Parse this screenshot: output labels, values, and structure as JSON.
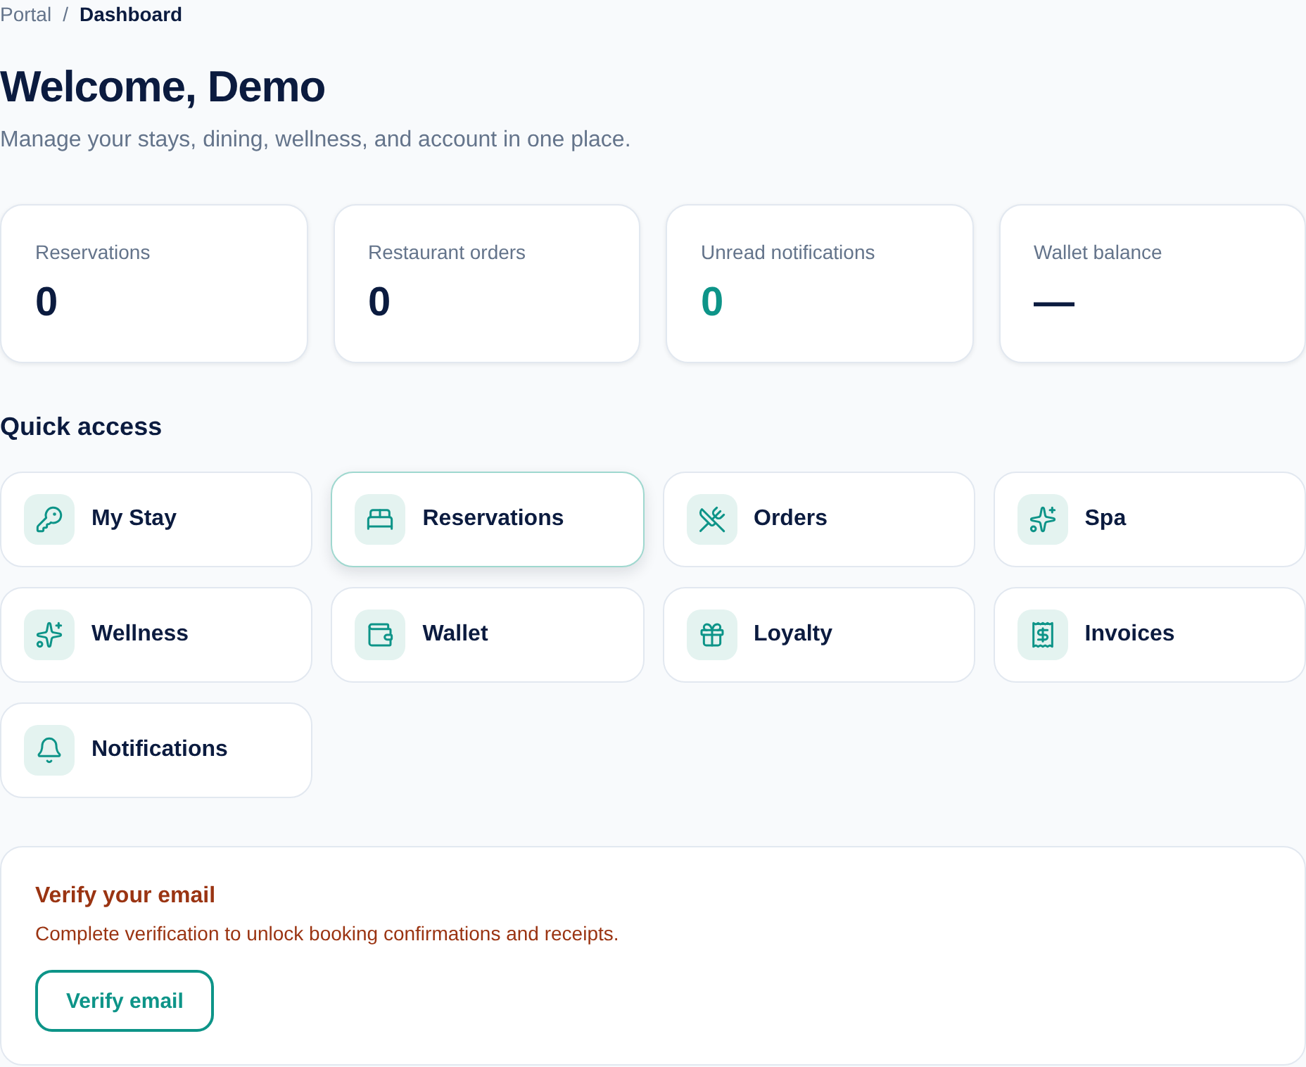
{
  "breadcrumb": {
    "items": [
      {
        "label": "Portal",
        "current": false
      },
      {
        "label": "Dashboard",
        "current": true
      }
    ],
    "separator": "/"
  },
  "header": {
    "title": "Welcome, Demo",
    "subtitle": "Manage your stays, dining, wellness, and account in one place."
  },
  "stats": [
    {
      "label": "Reservations",
      "value": "0",
      "color": "#0b1b3f"
    },
    {
      "label": "Restaurant orders",
      "value": "0",
      "color": "#0b1b3f"
    },
    {
      "label": "Unread notifications",
      "value": "0",
      "color": "#0d9488"
    },
    {
      "label": "Wallet balance",
      "value": "—",
      "color": "#0b1b3f"
    }
  ],
  "quick_access": {
    "title": "Quick access",
    "items": [
      {
        "label": "My Stay",
        "selected": false
      },
      {
        "label": "Reservations",
        "selected": true
      },
      {
        "label": "Orders",
        "selected": false
      },
      {
        "label": "Spa",
        "selected": false
      },
      {
        "label": "Wellness",
        "selected": false
      },
      {
        "label": "Wallet",
        "selected": false
      },
      {
        "label": "Loyalty",
        "selected": false
      },
      {
        "label": "Invoices",
        "selected": false
      },
      {
        "label": "Notifications",
        "selected": false
      }
    ]
  },
  "verify_banner": {
    "title": "Verify your email",
    "text": "Complete verification to unlock booking confirmations and receipts.",
    "button": "Verify email"
  }
}
